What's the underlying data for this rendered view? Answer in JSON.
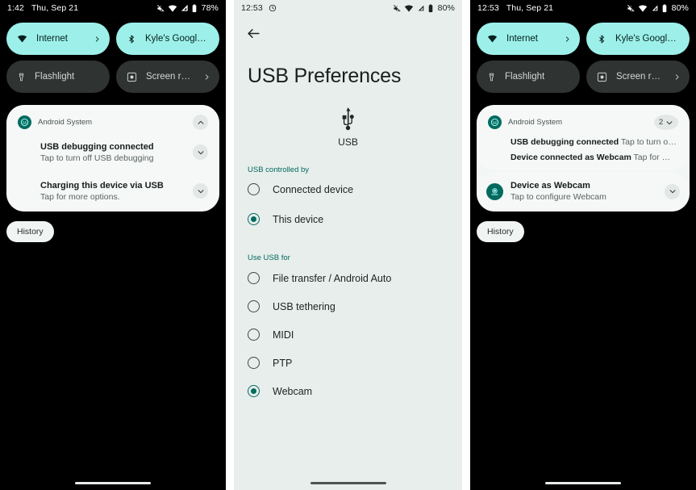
{
  "panel_quick_settings_left": {
    "status_bar": {
      "time": "1:42",
      "date": "Thu, Sep 21",
      "battery_percent": "78%",
      "icons": [
        "mute-icon",
        "wifi-icon",
        "signal-icon",
        "battery-icon"
      ]
    },
    "tiles": [
      {
        "label": "Internet",
        "icon": "wifi-icon",
        "state": "on",
        "chevron": true
      },
      {
        "label": "Kyle's Google Pi.",
        "icon": "bluetooth-icon",
        "state": "on",
        "chevron": false
      },
      {
        "label": "Flashlight",
        "icon": "flashlight-icon",
        "state": "off",
        "chevron": false
      },
      {
        "label": "Screen record",
        "icon": "screen-record-icon",
        "state": "off",
        "chevron": true
      }
    ],
    "notification_group": {
      "app_name": "Android System",
      "app_icon": "android-system-icon",
      "expanded": true,
      "expand_icon": "chevron-up-icon",
      "items": [
        {
          "title": "USB debugging connected",
          "body": "Tap to turn off USB debugging",
          "chevron": "chevron-down-icon"
        },
        {
          "title": "Charging this device via USB",
          "body": "Tap for more options.",
          "chevron": "chevron-down-icon"
        }
      ]
    },
    "history_label": "History"
  },
  "panel_usb_preferences": {
    "status_bar": {
      "time": "12:53",
      "battery_percent": "80%",
      "icons": [
        "clock-icon",
        "mute-icon",
        "wifi-icon",
        "signal-icon",
        "battery-icon"
      ]
    },
    "back_icon": "back-arrow-icon",
    "title": "USB Preferences",
    "hero": {
      "icon": "usb-icon",
      "caption": "USB"
    },
    "sections": [
      {
        "label": "USB controlled by",
        "options": [
          {
            "label": "Connected device",
            "selected": false
          },
          {
            "label": "This device",
            "selected": true
          }
        ]
      },
      {
        "label": "Use USB for",
        "options": [
          {
            "label": "File transfer / Android Auto",
            "selected": false
          },
          {
            "label": "USB tethering",
            "selected": false
          },
          {
            "label": "MIDI",
            "selected": false
          },
          {
            "label": "PTP",
            "selected": false
          },
          {
            "label": "Webcam",
            "selected": true
          }
        ]
      }
    ]
  },
  "panel_quick_settings_right": {
    "status_bar": {
      "time": "12:53",
      "date": "Thu, Sep 21",
      "battery_percent": "80%",
      "icons": [
        "mute-icon",
        "wifi-icon",
        "signal-icon",
        "battery-icon"
      ]
    },
    "tiles": [
      {
        "label": "Internet",
        "icon": "wifi-icon",
        "state": "on",
        "chevron": true
      },
      {
        "label": "Kyle's Google Pi.",
        "icon": "bluetooth-icon",
        "state": "on",
        "chevron": false
      },
      {
        "label": "Flashlight",
        "icon": "flashlight-icon",
        "state": "off",
        "chevron": false
      },
      {
        "label": "Screen record",
        "icon": "screen-record-icon",
        "state": "off",
        "chevron": true
      }
    ],
    "notification_group": {
      "app_name": "Android System",
      "app_icon": "android-system-icon",
      "collapsed_count": "2",
      "expand_icon": "chevron-down-icon",
      "items": [
        {
          "title": "USB debugging connected",
          "body": "Tap to turn off USB…"
        },
        {
          "title": "Device connected as Webcam",
          "body": "Tap for more op…"
        }
      ]
    },
    "notification_single": {
      "app_icon": "webcam-icon",
      "title": "Device as Webcam",
      "body": "Tap to configure Webcam",
      "chevron": "chevron-down-icon"
    },
    "history_label": "History"
  },
  "colors": {
    "tile_on_bg": "#9CF0E9",
    "tile_off_bg": "#2F3331",
    "shade_bg": "#000000",
    "prefs_bg": "#E8EEEC",
    "notification_bg": "#F5F8F6",
    "accent_teal": "#046A60",
    "section_label": "#00695E",
    "text_primary": "#171D1B",
    "text_secondary": "#5B6360"
  }
}
